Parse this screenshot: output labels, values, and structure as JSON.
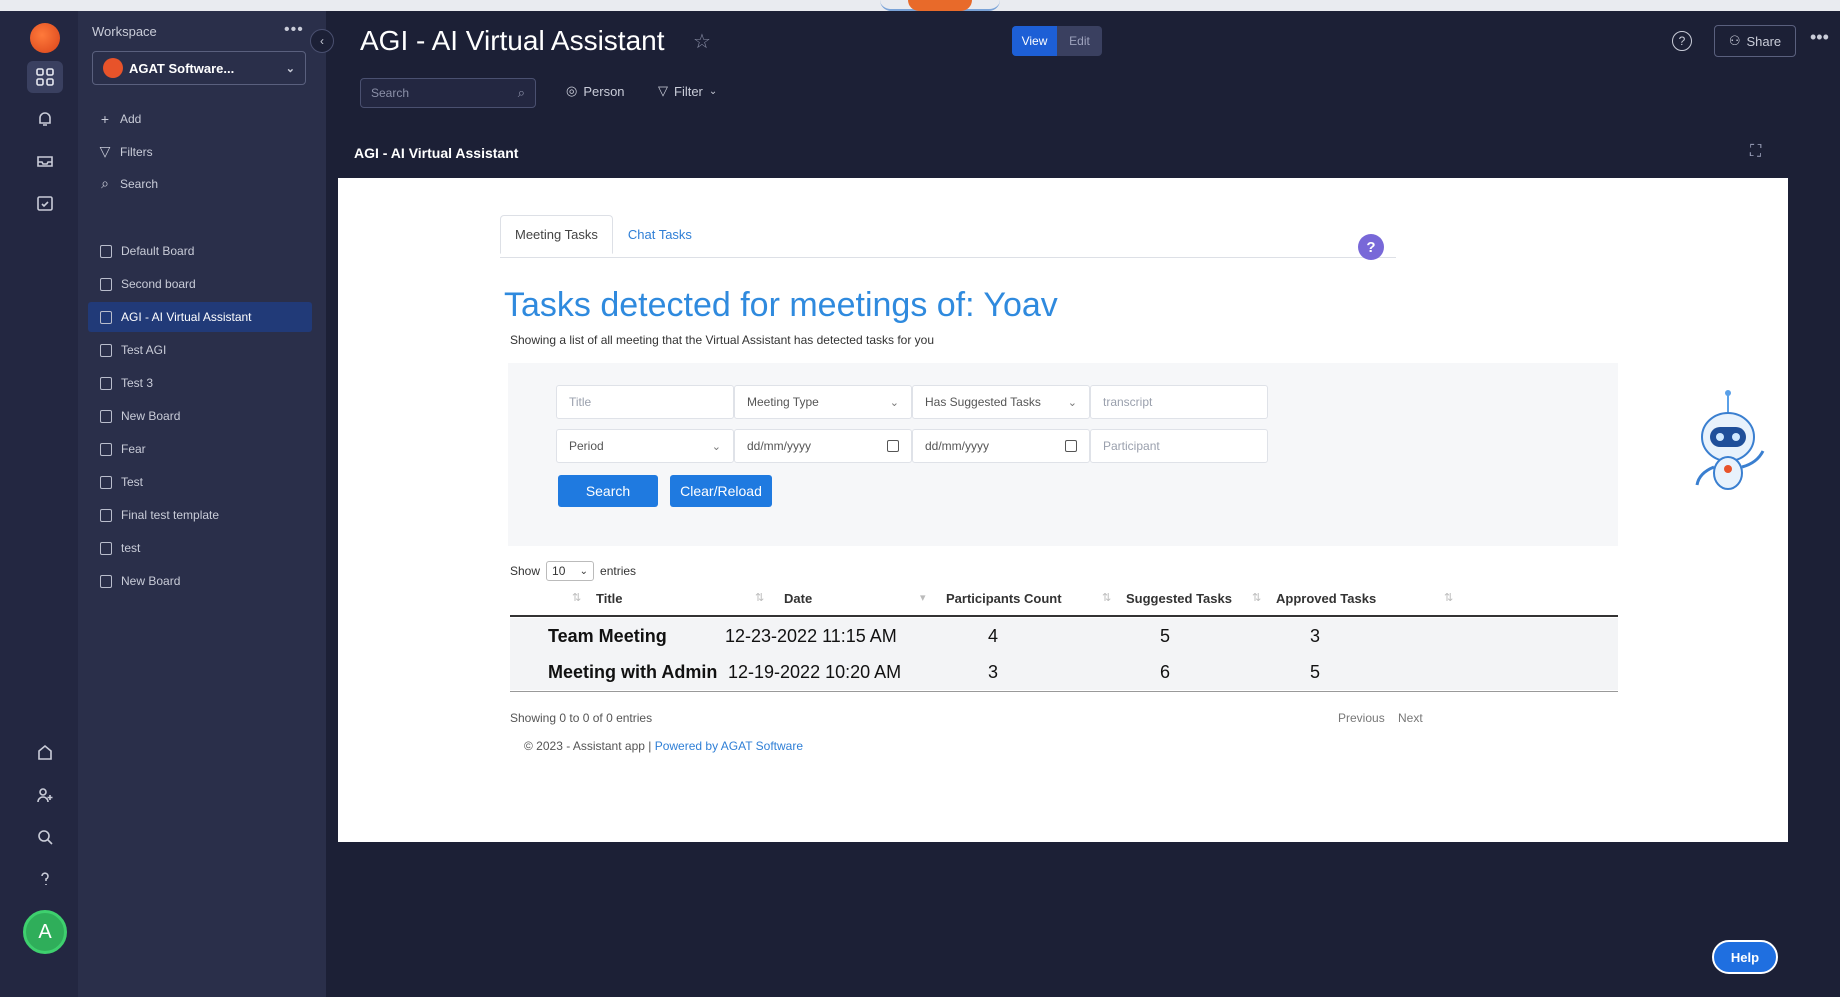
{
  "rail": {
    "avatar_initial": "A"
  },
  "sidebar": {
    "workspace_label": "Workspace",
    "workspace_name": "AGAT Software...",
    "actions": [
      {
        "label": "Add"
      },
      {
        "label": "Filters"
      },
      {
        "label": "Search"
      }
    ],
    "boards": [
      {
        "label": "Default Board"
      },
      {
        "label": "Second board"
      },
      {
        "label": "AGI - AI Virtual Assistant"
      },
      {
        "label": "Test AGI"
      },
      {
        "label": "Test 3"
      },
      {
        "label": "New Board"
      },
      {
        "label": "Fear"
      },
      {
        "label": "Test"
      },
      {
        "label": "Final test template"
      },
      {
        "label": "test"
      },
      {
        "label": "New Board"
      }
    ]
  },
  "header": {
    "title": "AGI - AI Virtual Assistant",
    "view_label": "View",
    "edit_label": "Edit",
    "share_label": "Share",
    "search_placeholder": "Search",
    "person_label": "Person",
    "filter_label": "Filter",
    "panel_title": "AGI - AI Virtual Assistant"
  },
  "app": {
    "tabs": [
      {
        "label": "Meeting Tasks"
      },
      {
        "label": "Chat Tasks"
      }
    ],
    "heading": "Tasks detected for meetings of: Yoav",
    "subheading": "Showing a list of all meeting that the Virtual Assistant has detected tasks for you",
    "filters": {
      "title_placeholder": "Title",
      "meeting_type": "Meeting Type",
      "has_suggested_tasks": "Has Suggested Tasks",
      "transcript_placeholder": "transcript",
      "period": "Period",
      "date_from": "dd/mm/yyyy",
      "date_to": "dd/mm/yyyy",
      "participant_placeholder": "Participant"
    },
    "search_button": "Search",
    "clear_button": "Clear/Reload",
    "show_label": "Show",
    "show_value": "10",
    "entries_label": "entries",
    "columns": [
      "Title",
      "Date",
      "Participants Count",
      "Suggested Tasks",
      "Approved Tasks"
    ],
    "rows": [
      {
        "title": "Team Meeting",
        "date": "12-23-2022 11:15 AM",
        "participants": "4",
        "suggested": "5",
        "approved": "3"
      },
      {
        "title": "Meeting with Admin",
        "date": "12-19-2022 10:20 AM",
        "participants": "3",
        "suggested": "6",
        "approved": "5"
      }
    ],
    "showing_text": "Showing 0 to 0 of 0 entries",
    "previous_label": "Previous",
    "next_label": "Next",
    "footer_text": "© 2023 - Assistant app | ",
    "footer_link": "Powered by AGAT Software"
  },
  "help_button": "Help"
}
